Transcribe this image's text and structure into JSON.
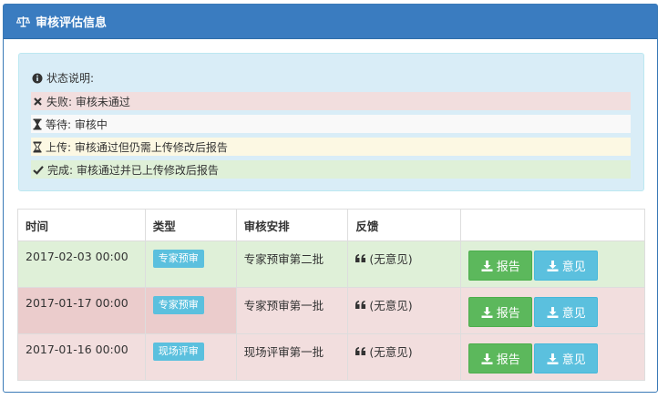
{
  "panel": {
    "title": "审核评估信息",
    "title_icon": "balance-scale-icon"
  },
  "legend": {
    "title": "状态说明:",
    "items": [
      {
        "key": "fail",
        "icon": "times-icon",
        "text": "失败: 审核未通过"
      },
      {
        "key": "wait",
        "icon": "hourglass-icon",
        "text": "等待: 审核中"
      },
      {
        "key": "upload",
        "icon": "hourglass-half-icon",
        "text": "上传: 审核通过但仍需上传修改后报告"
      },
      {
        "key": "done",
        "icon": "check-icon",
        "text": "完成: 审核通过并已上传修改后报告"
      }
    ]
  },
  "table": {
    "headers": [
      "时间",
      "类型",
      "审核安排",
      "反馈",
      ""
    ],
    "rows": [
      {
        "time": "2017-02-03 00:00",
        "type": "专家预审",
        "arrangement": "专家预审第二批",
        "feedback": "(无意见)",
        "report_label": "报告",
        "opinion_label": "意见",
        "status": "done"
      },
      {
        "time": "2017-01-17 00:00",
        "type": "专家预审",
        "arrangement": "专家预审第一批",
        "feedback": "(无意见)",
        "report_label": "报告",
        "opinion_label": "意见",
        "status": "fail"
      },
      {
        "time": "2017-01-16 00:00",
        "type": "现场评审",
        "arrangement": "现场评审第一批",
        "feedback": "(无意见)",
        "report_label": "报告",
        "opinion_label": "意见",
        "status": "fail"
      }
    ]
  },
  "colors": {
    "heading": "#3a7cc0",
    "success": "#5cb85c",
    "info": "#5bc0de",
    "danger_bg": "#f2dede",
    "success_bg": "#dff0d8",
    "warning_bg": "#fcf8e3"
  }
}
